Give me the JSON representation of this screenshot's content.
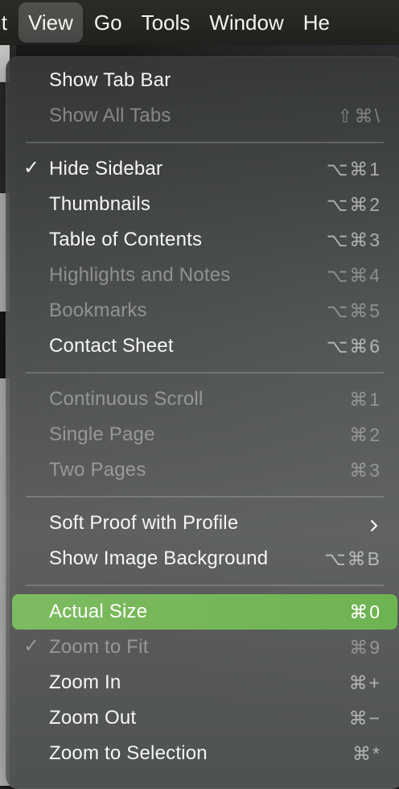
{
  "menubar": {
    "items": [
      "it",
      "View",
      "Go",
      "Tools",
      "Window",
      "He"
    ],
    "active_index": 1
  },
  "menu": {
    "sections": [
      [
        {
          "label": "Show Tab Bar",
          "shortcut": "",
          "enabled": true,
          "checked": false,
          "submenu": false,
          "highlighted": false
        },
        {
          "label": "Show All Tabs",
          "shortcut": "⇧⌘\\",
          "enabled": false,
          "checked": false,
          "submenu": false,
          "highlighted": false
        }
      ],
      [
        {
          "label": "Hide Sidebar",
          "shortcut": "⌥⌘1",
          "enabled": true,
          "checked": true,
          "submenu": false,
          "highlighted": false
        },
        {
          "label": "Thumbnails",
          "shortcut": "⌥⌘2",
          "enabled": true,
          "checked": false,
          "submenu": false,
          "highlighted": false
        },
        {
          "label": "Table of Contents",
          "shortcut": "⌥⌘3",
          "enabled": true,
          "checked": false,
          "submenu": false,
          "highlighted": false
        },
        {
          "label": "Highlights and Notes",
          "shortcut": "⌥⌘4",
          "enabled": false,
          "checked": false,
          "submenu": false,
          "highlighted": false
        },
        {
          "label": "Bookmarks",
          "shortcut": "⌥⌘5",
          "enabled": false,
          "checked": false,
          "submenu": false,
          "highlighted": false
        },
        {
          "label": "Contact Sheet",
          "shortcut": "⌥⌘6",
          "enabled": true,
          "checked": false,
          "submenu": false,
          "highlighted": false
        }
      ],
      [
        {
          "label": "Continuous Scroll",
          "shortcut": "⌘1",
          "enabled": false,
          "checked": false,
          "submenu": false,
          "highlighted": false
        },
        {
          "label": "Single Page",
          "shortcut": "⌘2",
          "enabled": false,
          "checked": false,
          "submenu": false,
          "highlighted": false
        },
        {
          "label": "Two Pages",
          "shortcut": "⌘3",
          "enabled": false,
          "checked": false,
          "submenu": false,
          "highlighted": false
        }
      ],
      [
        {
          "label": "Soft Proof with Profile",
          "shortcut": "",
          "enabled": true,
          "checked": false,
          "submenu": true,
          "highlighted": false
        },
        {
          "label": "Show Image Background",
          "shortcut": "⌥⌘B",
          "enabled": true,
          "checked": false,
          "submenu": false,
          "highlighted": false
        }
      ],
      [
        {
          "label": "Actual Size",
          "shortcut": "⌘0",
          "enabled": true,
          "checked": false,
          "submenu": false,
          "highlighted": true
        },
        {
          "label": "Zoom to Fit",
          "shortcut": "⌘9",
          "enabled": false,
          "checked": true,
          "submenu": false,
          "highlighted": false
        },
        {
          "label": "Zoom In",
          "shortcut": "⌘+",
          "enabled": true,
          "checked": false,
          "submenu": false,
          "highlighted": false
        },
        {
          "label": "Zoom Out",
          "shortcut": "⌘−",
          "enabled": true,
          "checked": false,
          "submenu": false,
          "highlighted": false
        },
        {
          "label": "Zoom to Selection",
          "shortcut": "⌘*",
          "enabled": true,
          "checked": false,
          "submenu": false,
          "highlighted": false
        }
      ]
    ]
  },
  "colors": {
    "highlight": "#74b656",
    "menubar_bg": "#2b2a26"
  }
}
